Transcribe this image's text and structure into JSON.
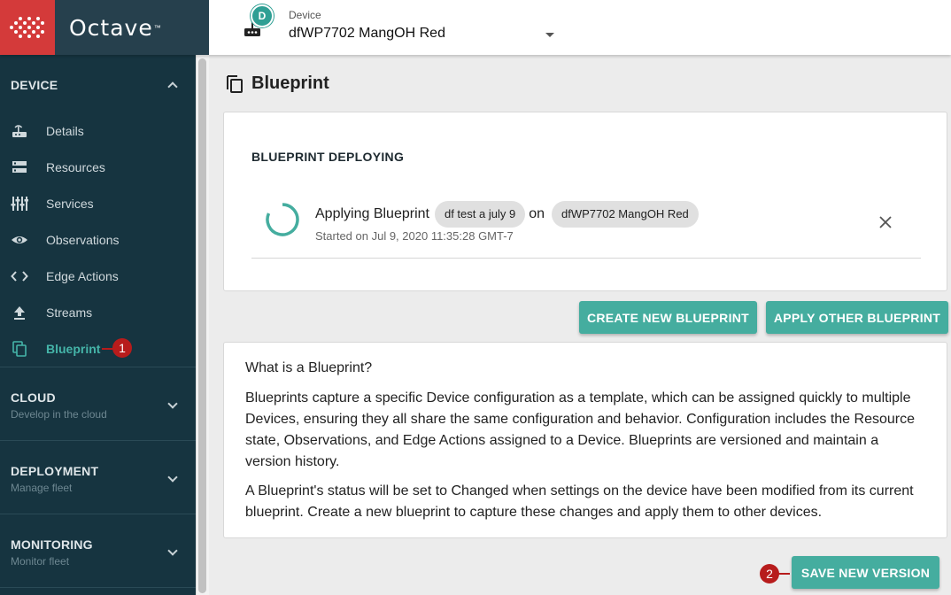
{
  "app": {
    "brand": "Octave",
    "brand_tm": "™"
  },
  "device_picker": {
    "label": "Device",
    "avatar_letter": "D",
    "selected": "dfWP7702 MangOH Red"
  },
  "sidebar": {
    "device_section": {
      "title": "DEVICE"
    },
    "items": [
      {
        "label": "Details",
        "icon": "router-icon"
      },
      {
        "label": "Resources",
        "icon": "storage-icon"
      },
      {
        "label": "Services",
        "icon": "equalizer-icon"
      },
      {
        "label": "Observations",
        "icon": "eye-icon"
      },
      {
        "label": "Edge Actions",
        "icon": "code-icon"
      },
      {
        "label": "Streams",
        "icon": "upload-icon"
      },
      {
        "label": "Blueprint",
        "icon": "copy-icon",
        "active": true
      }
    ],
    "cloud": {
      "title": "CLOUD",
      "subtitle": "Develop in the cloud"
    },
    "deployment": {
      "title": "DEPLOYMENT",
      "subtitle": "Manage fleet"
    },
    "monitoring": {
      "title": "MONITORING",
      "subtitle": "Monitor fleet"
    }
  },
  "callouts": {
    "one": "1",
    "two": "2"
  },
  "main": {
    "title": "Blueprint",
    "deploy": {
      "heading": "BLUEPRINT DEPLOYING",
      "applying": "Applying Blueprint",
      "blueprint_chip": "df test a july 9",
      "on": "on",
      "device_chip": "dfWP7702 MangOH Red",
      "started": "Started on Jul 9, 2020 11:35:28 GMT-7"
    },
    "buttons": {
      "create": "CREATE NEW BLUEPRINT",
      "apply": "APPLY OTHER BLUEPRINT",
      "save": "SAVE NEW VERSION"
    },
    "info": {
      "title": "What is a Blueprint?",
      "p1": "Blueprints capture a specific Device configuration as a template, which can be assigned quickly to multiple Devices, ensuring they all share the same configuration and behavior. Configuration includes the Resource state, Observations, and Edge Actions assigned to a Device. Blueprints are versioned and maintain a version history.",
      "p2": "A Blueprint's status will be set to Changed when settings on the device have been modified from its current blueprint. Create a new blueprint to capture these changes and apply them to other devices."
    }
  },
  "colors": {
    "accent": "#45ad9f",
    "sidebar_bg": "#163440",
    "logo_red": "#d43a3a",
    "logo_dark": "#26404d",
    "callout_red": "#b71c1c"
  }
}
